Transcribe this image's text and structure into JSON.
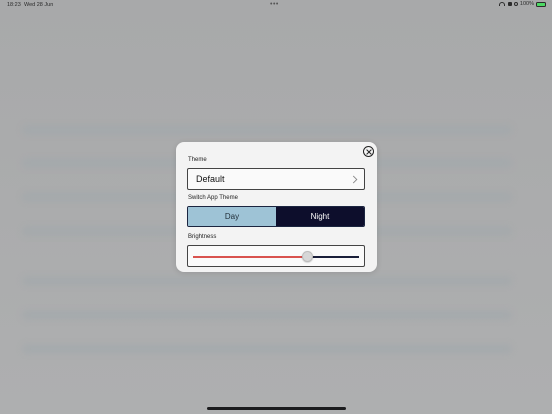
{
  "status_bar": {
    "time": "18:23",
    "date": "Wed 28 Jun",
    "dots": "•••",
    "battery": "100%"
  },
  "modal": {
    "theme_label": "Theme",
    "theme_value": "Default",
    "switch_label": "Switch App Theme",
    "day_label": "Day",
    "night_label": "Night",
    "selected_theme_mode": "Day",
    "brightness_label": "Brightness",
    "brightness_value": 0.69
  },
  "colors": {
    "day_selected": "#9ec3d6",
    "night": "#0d0e2c",
    "slider_active": "#d9534f",
    "slider_inactive": "#1a1f3a"
  }
}
